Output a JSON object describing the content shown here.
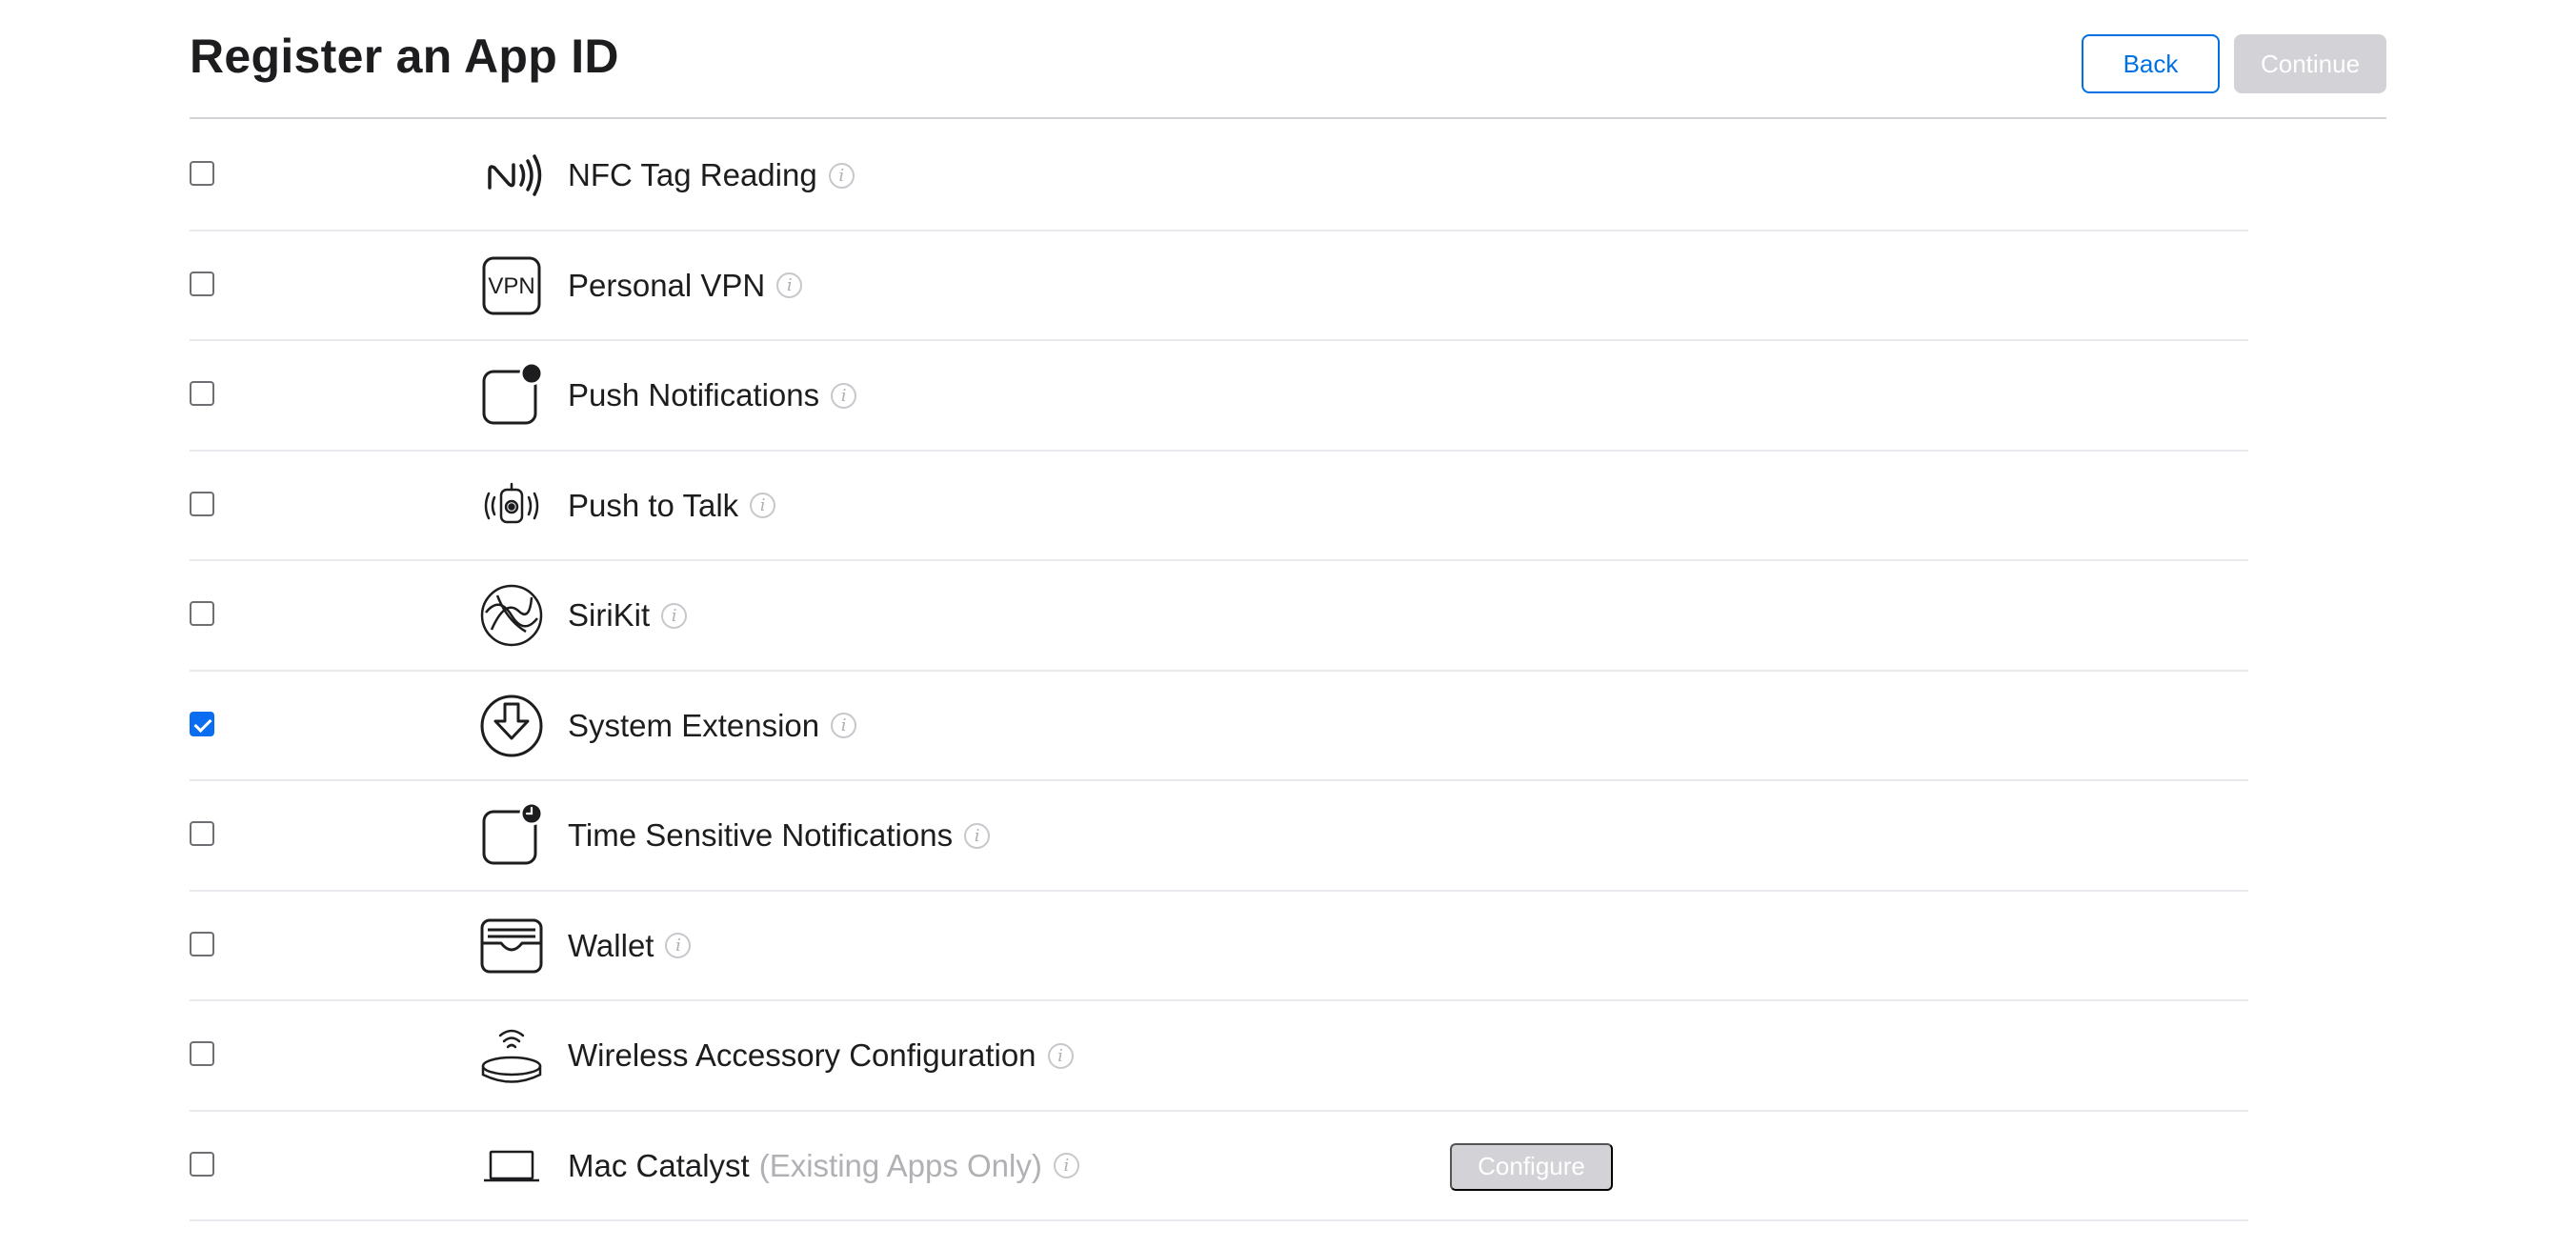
{
  "header": {
    "title": "Register an App ID",
    "back_label": "Back",
    "continue_label": "Continue"
  },
  "capabilities": [
    {
      "label": "NFC Tag Reading",
      "icon": "nfc-icon",
      "checked": false
    },
    {
      "label": "Personal VPN",
      "icon": "vpn-icon",
      "icon_text": "VPN",
      "checked": false
    },
    {
      "label": "Push Notifications",
      "icon": "push-notification-icon",
      "checked": false
    },
    {
      "label": "Push to Talk",
      "icon": "push-to-talk-icon",
      "checked": false
    },
    {
      "label": "SiriKit",
      "icon": "sirikit-icon",
      "checked": false
    },
    {
      "label": "System Extension",
      "icon": "system-extension-icon",
      "checked": true
    },
    {
      "label": "Time Sensitive Notifications",
      "icon": "time-sensitive-icon",
      "checked": false
    },
    {
      "label": "Wallet",
      "icon": "wallet-icon",
      "checked": false
    },
    {
      "label": "Wireless Accessory Configuration",
      "icon": "wireless-accessory-icon",
      "checked": false
    },
    {
      "label": "Mac Catalyst",
      "note": "(Existing Apps Only)",
      "icon": "mac-catalyst-icon",
      "checked": false,
      "configure_label": "Configure"
    }
  ],
  "info_glyph": "i",
  "colors": {
    "accent": "#0071e3",
    "checkbox_checked": "#0a6cf0",
    "disabled_button": "#d2d2d7",
    "divider": "#e8e8ed"
  }
}
